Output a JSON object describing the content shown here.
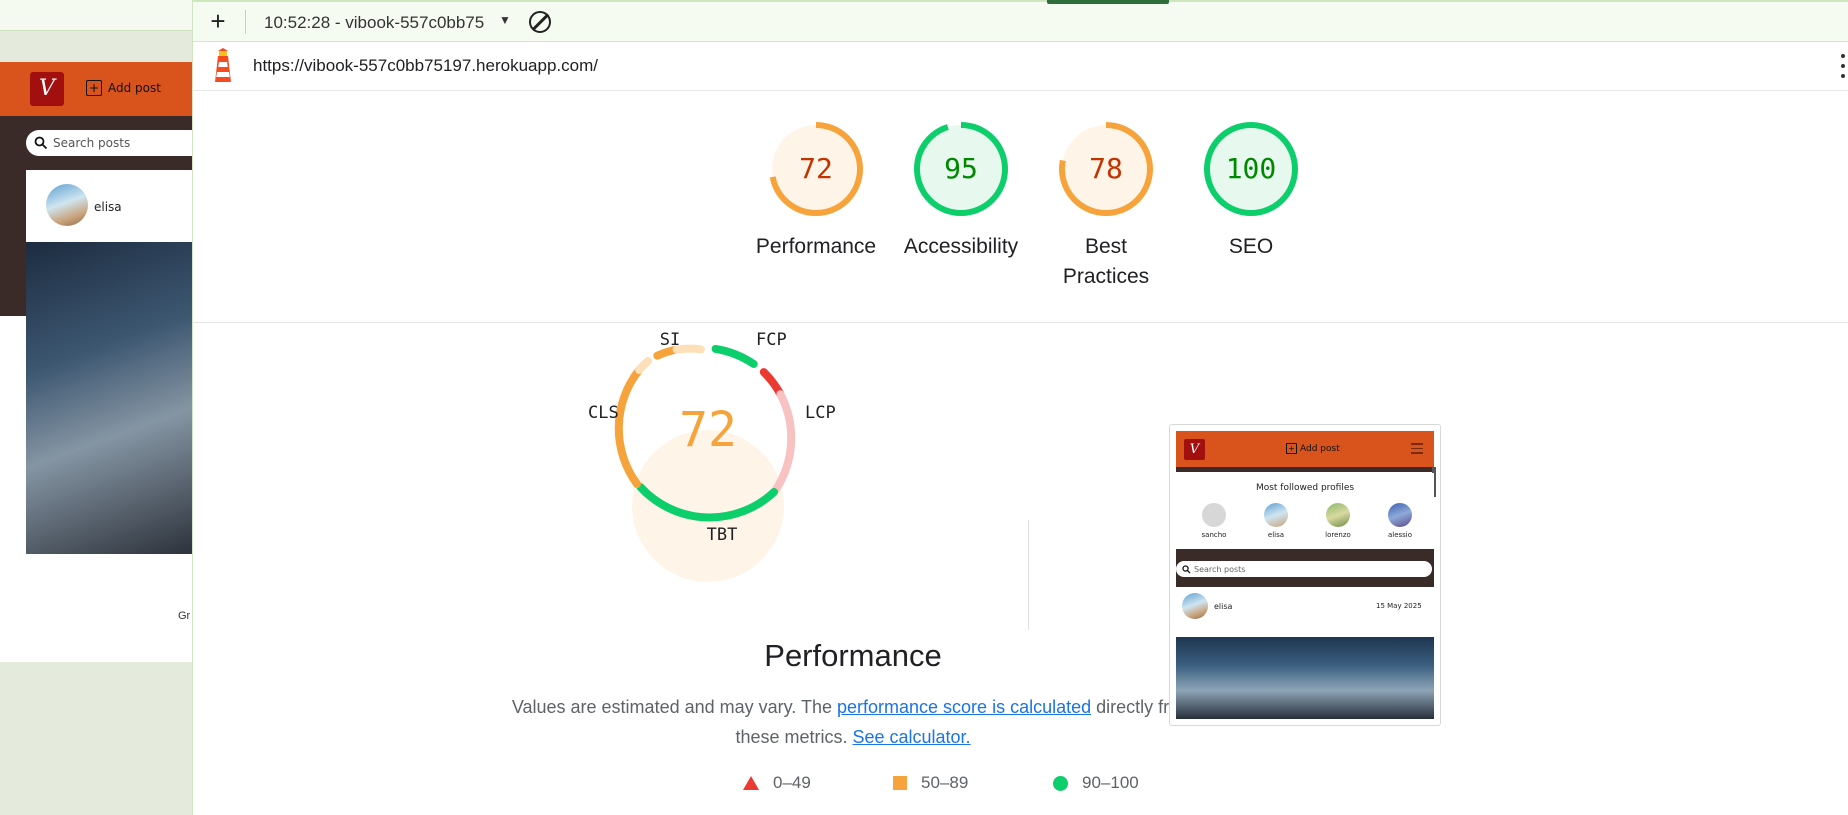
{
  "background_app": {
    "logo": "V",
    "add_post_label": "Add post",
    "search_placeholder": "Search posts",
    "username": "elisa",
    "text_fragment": "Gr"
  },
  "toolbar": {
    "new_label": "+",
    "report_title": "10:52:28 - vibook-557c0bb75",
    "url": "https://vibook-557c0bb75197.herokuapp.com/"
  },
  "scores": [
    {
      "score": "72",
      "label": "Performance",
      "color": "#f7a33c"
    },
    {
      "score": "95",
      "label": "Accessibility",
      "color": "#0cce6b"
    },
    {
      "score": "78",
      "label": "Best Practices",
      "color": "#f7a33c"
    },
    {
      "score": "100",
      "label": "SEO",
      "color": "#0cce6b"
    }
  ],
  "performance": {
    "score": "72",
    "title": "Performance",
    "metric_labels": {
      "si": "SI",
      "fcp": "FCP",
      "lcp": "LCP",
      "tbt": "TBT",
      "cls": "CLS"
    },
    "description_text_1": "Values are estimated and may vary. The ",
    "link_score": "performance score is calculated",
    "description_text_2": " directly from these metrics. ",
    "link_calculator": "See calculator.",
    "legend": [
      {
        "range": "0–49",
        "shape": "triangle",
        "color": "#eb3a32"
      },
      {
        "range": "50–89",
        "shape": "square",
        "color": "#f7a33c"
      },
      {
        "range": "90–100",
        "shape": "circle",
        "color": "#0cce6b"
      }
    ]
  },
  "screenshot": {
    "logo": "V",
    "add_post_label": "Add post",
    "most_followed_title": "Most followed profiles",
    "profiles": [
      "sancho",
      "elisa",
      "lorenzo",
      "alessio"
    ],
    "search_placeholder": "Search posts",
    "post_user": "elisa",
    "post_date": "15 May 2025"
  },
  "colors": {
    "pass": "#0cce6b",
    "average": "#f7a33c",
    "fail": "#eb3a32",
    "brand": "#d9541d"
  }
}
